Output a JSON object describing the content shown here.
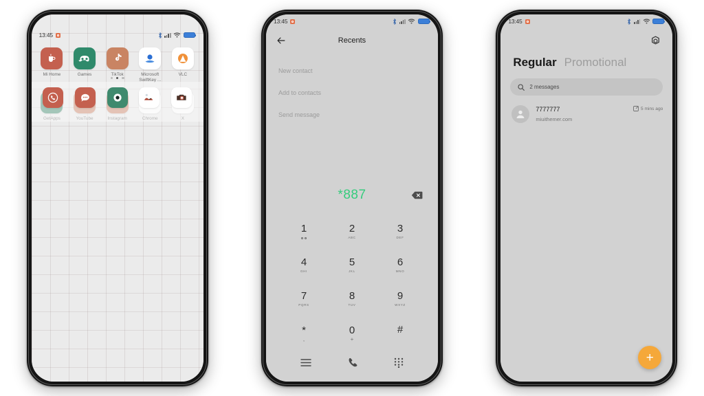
{
  "statusbar": {
    "time": "13:45",
    "alarm_icon": "alarm-icon",
    "bluetooth_icon": "bluetooth-icon",
    "signal_icon": "cellular-signal-icon",
    "wifi_icon": "wifi-icon",
    "battery_icon": "battery-icon"
  },
  "colors": {
    "screen_bg": "#d2d2d2",
    "home_bg": "#ebebeb",
    "dial_green": "#36cc7d",
    "fab_orange": "#f5a83a",
    "battery_blue": "#3c7fd8",
    "accent_terracotta": "#c4604f",
    "accent_green": "#3f8a6e"
  },
  "phone1_home": {
    "apps_row1": [
      {
        "label": "Mi Home",
        "icon": "mi-home-icon",
        "bg": "#c4604f",
        "fg": "#ffffff"
      },
      {
        "label": "Games",
        "icon": "games-icon",
        "bg": "#2f8a6b",
        "fg": "#ffffff"
      },
      {
        "label": "TikTok",
        "icon": "tiktok-icon",
        "bg": "#c98463",
        "fg": "#ffffff"
      },
      {
        "label": "Microsoft SwiftKey ...",
        "icon": "swiftkey-icon",
        "bg": "#ffffff",
        "fg": "#2b6fd4"
      },
      {
        "label": "VLC",
        "icon": "vlc-icon",
        "bg": "#ffffff",
        "fg": "#f0913a"
      }
    ],
    "apps_row2": [
      {
        "label": "GetApps",
        "icon": "getapps-icon",
        "bg": "#3f8a6e",
        "fg": "#ffffff"
      },
      {
        "label": "YouTube",
        "icon": "youtube-icon",
        "bg": "#cd8367",
        "fg": "#ffffff"
      },
      {
        "label": "Instagram",
        "icon": "instagram-icon",
        "bg": "#cd8367",
        "fg": "#ffffff"
      },
      {
        "label": "Chrome",
        "icon": "chrome-icon",
        "bg": "#ffffff",
        "fg": "#2f8a4f"
      },
      {
        "label": "X",
        "icon": "x-twitter-icon",
        "bg": "#ffffff",
        "fg": "#000000"
      }
    ],
    "page_dots": {
      "count": 3,
      "active_index": 1
    },
    "dock": [
      {
        "label": "Phone",
        "icon": "phone-dock-icon",
        "bg": "#c4604f"
      },
      {
        "label": "Messages",
        "icon": "messages-dock-icon",
        "bg": "#c4604f"
      },
      {
        "label": "Browser",
        "icon": "browser-dock-icon",
        "bg": "#3f8a6e"
      },
      {
        "label": "Gallery",
        "icon": "gallery-dock-icon",
        "bg": "#ffffff"
      },
      {
        "label": "Camera",
        "icon": "camera-dock-icon",
        "bg": "#ffffff"
      }
    ]
  },
  "phone2_dialer": {
    "back_icon": "back-arrow-icon",
    "title": "Recents",
    "quick_actions": [
      "New contact",
      "Add to contacts",
      "Send message"
    ],
    "dialed_number": "*887",
    "backspace_icon": "backspace-icon",
    "keypad": [
      {
        "digit": "1",
        "sub": "",
        "sub_type": "voicemail"
      },
      {
        "digit": "2",
        "sub": "ABC",
        "sub_type": "letters"
      },
      {
        "digit": "3",
        "sub": "DEF",
        "sub_type": "letters"
      },
      {
        "digit": "4",
        "sub": "GHI",
        "sub_type": "letters"
      },
      {
        "digit": "5",
        "sub": "JKL",
        "sub_type": "letters"
      },
      {
        "digit": "6",
        "sub": "MNO",
        "sub_type": "letters"
      },
      {
        "digit": "7",
        "sub": "PQRS",
        "sub_type": "letters"
      },
      {
        "digit": "8",
        "sub": "TUV",
        "sub_type": "letters"
      },
      {
        "digit": "9",
        "sub": "WXYZ",
        "sub_type": "letters"
      },
      {
        "digit": "*",
        "sub": ",",
        "sub_type": "plus"
      },
      {
        "digit": "0",
        "sub": "+",
        "sub_type": "plus"
      },
      {
        "digit": "#",
        "sub": "",
        "sub_type": "letters"
      }
    ],
    "bottom_bar": [
      {
        "icon": "menu-icon",
        "label": "Menu"
      },
      {
        "icon": "call-icon",
        "label": "Call"
      },
      {
        "icon": "keypad-icon",
        "label": "Keypad"
      }
    ]
  },
  "phone3_messages": {
    "gear_icon": "gear-icon",
    "tabs": [
      {
        "label": "Regular",
        "active": true
      },
      {
        "label": "Promotional",
        "active": false
      }
    ],
    "search": {
      "icon": "search-icon",
      "text": "2 messages"
    },
    "conversations": [
      {
        "avatar_icon": "person-avatar-icon",
        "name": "7777777",
        "snippet": "miuithemer.com",
        "status_icon": "sent-icon",
        "time": "5 mins ago"
      }
    ],
    "fab": {
      "icon": "plus-icon",
      "label": "New conversation"
    }
  }
}
